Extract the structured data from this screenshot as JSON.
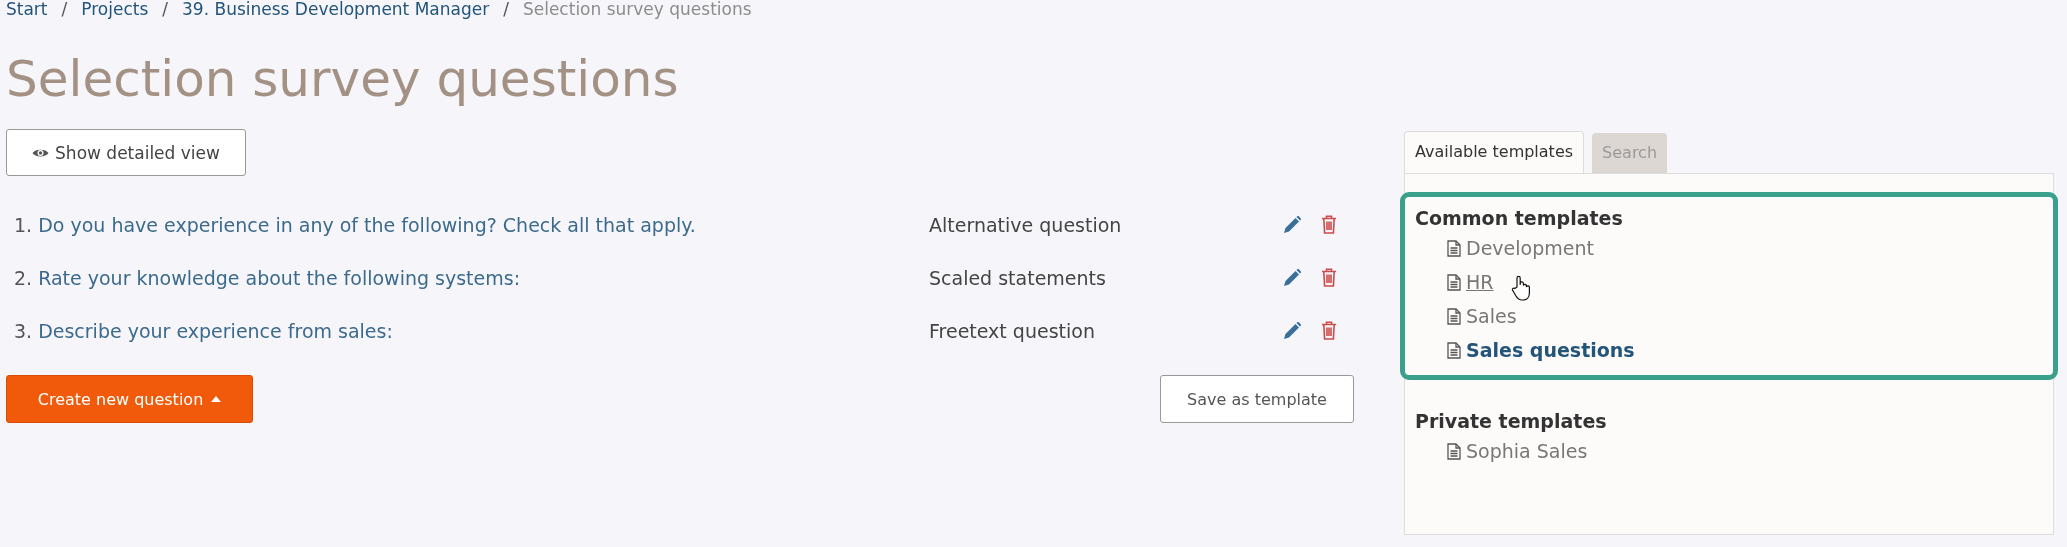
{
  "breadcrumb": {
    "items": [
      {
        "label": "Start",
        "current": false
      },
      {
        "label": "Projects",
        "current": false
      },
      {
        "label": "39. Business Development Manager",
        "current": false
      },
      {
        "label": "Selection survey questions",
        "current": true
      }
    ],
    "separators": [
      "/",
      "/",
      "/"
    ]
  },
  "title": "Selection survey questions",
  "detail_button": {
    "label": "Show detailed view"
  },
  "questions": [
    {
      "number": "1.",
      "text": "Do you have experience in any of the following? Check all that apply.",
      "type": "Alternative question"
    },
    {
      "number": "2.",
      "text": "Rate your knowledge about the following systems:",
      "type": "Scaled statements"
    },
    {
      "number": "3.",
      "text": "Describe your experience from sales:",
      "type": "Freetext question"
    }
  ],
  "create_button": {
    "label": "Create new question"
  },
  "save_button": {
    "label": "Save as template"
  },
  "templates": {
    "tabs": [
      {
        "label": "Available templates",
        "selected": true
      },
      {
        "label": "Search",
        "selected": false
      }
    ],
    "groups": [
      {
        "title": "Common templates",
        "highlighted": true,
        "items": [
          {
            "label": "Development",
            "selected": false,
            "hovered": false
          },
          {
            "label": "HR",
            "selected": false,
            "hovered": true
          },
          {
            "label": "Sales",
            "selected": false,
            "hovered": false
          },
          {
            "label": "Sales questions",
            "selected": true,
            "hovered": false
          }
        ]
      },
      {
        "title": "Private templates",
        "highlighted": false,
        "items": [
          {
            "label": "Sophia Sales",
            "selected": false,
            "hovered": false
          }
        ]
      }
    ]
  }
}
